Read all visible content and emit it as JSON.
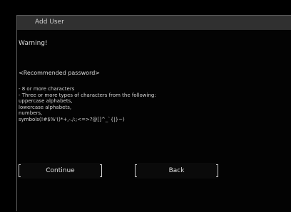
{
  "dialog": {
    "title": "Add User"
  },
  "body": {
    "warning": "Warning!",
    "recommendation_heading": "<Recommended password>",
    "recommendation_lines": [
      "- 8 or more characters",
      "- Three or more types of characters from the following:",
      "  uppercase alphabets,",
      "  lowercase alphabets,",
      "  numbers,",
      "  symbols(!#$%'()*+,-./:;<=>?@[]^_`{|}~)"
    ]
  },
  "buttons": {
    "continue_label": "Continue",
    "back_label": "Back"
  }
}
